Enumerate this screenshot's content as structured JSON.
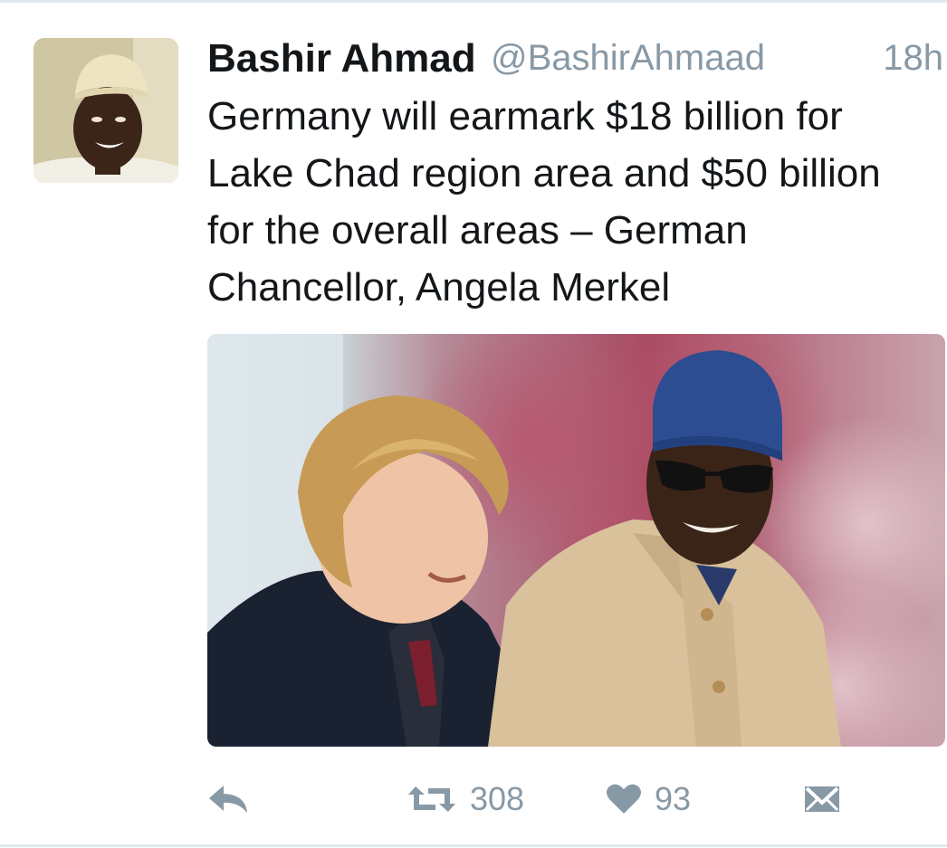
{
  "tweet": {
    "author": {
      "display_name": "Bashir Ahmad",
      "handle": "@BashirAhmaad"
    },
    "timestamp": "18h",
    "text_lines": [
      "Germany will earmark $18 billion for",
      "Lake Chad region area and $50 billion",
      "for the overall areas – German",
      "Chancellor, Angela Merkel"
    ],
    "stats": {
      "retweets": "308",
      "likes": "93"
    }
  },
  "icons": {
    "reply": "reply-icon",
    "retweet": "retweet-icon",
    "like": "heart-icon",
    "dm": "direct-message-icon"
  },
  "colors": {
    "text": "#14171a",
    "secondary": "#8899a6",
    "divider": "#e1e8ed"
  }
}
